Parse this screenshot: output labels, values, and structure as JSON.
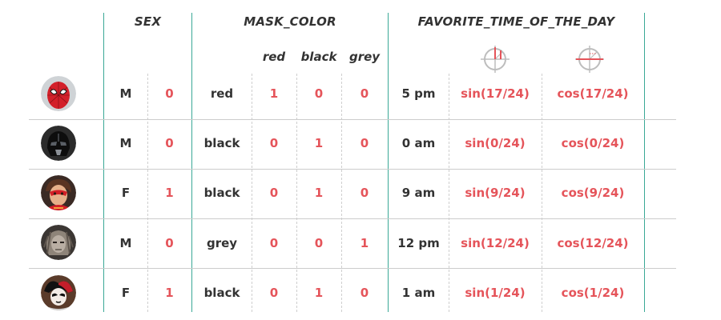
{
  "headers": {
    "sex": "SEX",
    "mask_color": "MASK_COLOR",
    "favorite_time": "FAVORITE_TIME_OF_THE_DAY",
    "mask_sub": [
      "red",
      "black",
      "grey"
    ]
  },
  "rows": [
    {
      "avatar": "spiderman-avatar",
      "sex": "M",
      "sex_enc": "0",
      "mask": "red",
      "red": "1",
      "black": "0",
      "grey": "0",
      "time": "5 pm",
      "sin": "sin(17/24)",
      "cos": "cos(17/24)"
    },
    {
      "avatar": "darth-vader-avatar",
      "sex": "M",
      "sex_enc": "0",
      "mask": "black",
      "red": "0",
      "black": "1",
      "grey": "0",
      "time": "0 am",
      "sin": "sin(0/24)",
      "cos": "cos(0/24)"
    },
    {
      "avatar": "elastigirl-avatar",
      "sex": "F",
      "sex_enc": "1",
      "mask": "black",
      "red": "0",
      "black": "1",
      "grey": "0",
      "time": "9 am",
      "sin": "sin(9/24)",
      "cos": "cos(9/24)"
    },
    {
      "avatar": "grey-mask-avatar",
      "sex": "M",
      "sex_enc": "0",
      "mask": "grey",
      "red": "0",
      "black": "0",
      "grey": "1",
      "time": "12 pm",
      "sin": "sin(12/24)",
      "cos": "cos(12/24)"
    },
    {
      "avatar": "harley-quinn-avatar",
      "sex": "F",
      "sex_enc": "1",
      "mask": "black",
      "red": "0",
      "black": "1",
      "grey": "0",
      "time": "1 am",
      "sin": "sin(1/24)",
      "cos": "cos(1/24)"
    }
  ],
  "icons": [
    "sine-unit-circle-icon",
    "cosine-unit-circle-icon"
  ],
  "colors": {
    "accent_red": "#e5545a",
    "rule_teal": "#3aa896",
    "text": "#333333"
  }
}
